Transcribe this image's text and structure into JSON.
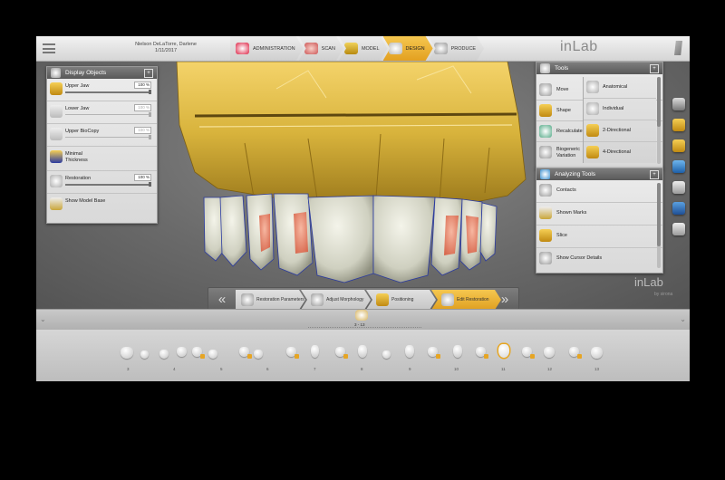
{
  "header": {
    "patient_name": "Nielson DeLaTorre, Darlene",
    "patient_date": "1/11/2017",
    "brand": "inLab",
    "steps": [
      {
        "label": "ADMINISTRATION",
        "state": "done"
      },
      {
        "label": "SCAN",
        "state": "done"
      },
      {
        "label": "MODEL",
        "state": "done"
      },
      {
        "label": "DESIGN",
        "state": "active"
      },
      {
        "label": "PRODUCE",
        "state": "todo"
      }
    ]
  },
  "display_objects": {
    "title": "Display Objects",
    "items": [
      {
        "label": "Upper Jaw",
        "percent": "100 %",
        "level": 1.0,
        "enabled": true,
        "icon": "upper-jaw-icon"
      },
      {
        "label": "Lower Jaw",
        "percent": "100 %",
        "level": 1.0,
        "enabled": false,
        "icon": "lower-jaw-icon"
      },
      {
        "label": "Upper BioCopy",
        "percent": "100 %",
        "level": 1.0,
        "enabled": false,
        "icon": "upper-biocopy-icon"
      },
      {
        "label": "Minimal Thickness",
        "percent": "",
        "level": null,
        "enabled": true,
        "icon": "minimal-thickness-icon"
      },
      {
        "label": "Restoration",
        "percent": "100 %",
        "level": 1.0,
        "enabled": true,
        "icon": "restoration-icon"
      },
      {
        "label": "Show Model Base",
        "percent": "",
        "level": null,
        "enabled": true,
        "icon": "model-base-icon"
      }
    ]
  },
  "tools": {
    "title": "Tools",
    "items": [
      {
        "label": "Move",
        "icon": "move-icon"
      },
      {
        "label": "Shape",
        "icon": "shape-icon"
      },
      {
        "label": "Recalculate",
        "icon": "recalculate-icon"
      },
      {
        "label": "Biogeneric Variation",
        "icon": "biogeneric-variation-icon"
      }
    ],
    "submenu": [
      {
        "label": "Anatomical",
        "icon": "anatomical-icon"
      },
      {
        "label": "Individual",
        "icon": "individual-icon"
      },
      {
        "label": "2-Directional",
        "icon": "two-directional-icon"
      },
      {
        "label": "4-Directional",
        "icon": "four-directional-icon"
      }
    ]
  },
  "analyzing_tools": {
    "title": "Analyzing Tools",
    "items": [
      {
        "label": "Contacts",
        "icon": "contacts-icon"
      },
      {
        "label": "Shown Marks",
        "icon": "shown-marks-icon"
      },
      {
        "label": "Slice",
        "icon": "slice-icon"
      },
      {
        "label": "Show Cursor Details",
        "icon": "cursor-details-icon"
      }
    ]
  },
  "wizard": {
    "prev": "«",
    "next": "»",
    "steps": [
      {
        "label": "Restoration Parameters",
        "state": "done"
      },
      {
        "label": "Adjust Morphology",
        "state": "done"
      },
      {
        "label": "Positioning",
        "state": "done"
      },
      {
        "label": "Edit Restoration",
        "state": "active"
      }
    ]
  },
  "viewport_brand": {
    "name": "inLab",
    "sub": "by sirona"
  },
  "tray": {
    "range": "3 - 13",
    "numbers": [
      "3",
      "4",
      "5",
      "6",
      "7",
      "8",
      "9",
      "10",
      "11",
      "12",
      "13"
    ],
    "selected": "11"
  },
  "colors": {
    "accent": "#e6a524",
    "gold": "#d8b33c",
    "dark_panel": "#616161"
  }
}
